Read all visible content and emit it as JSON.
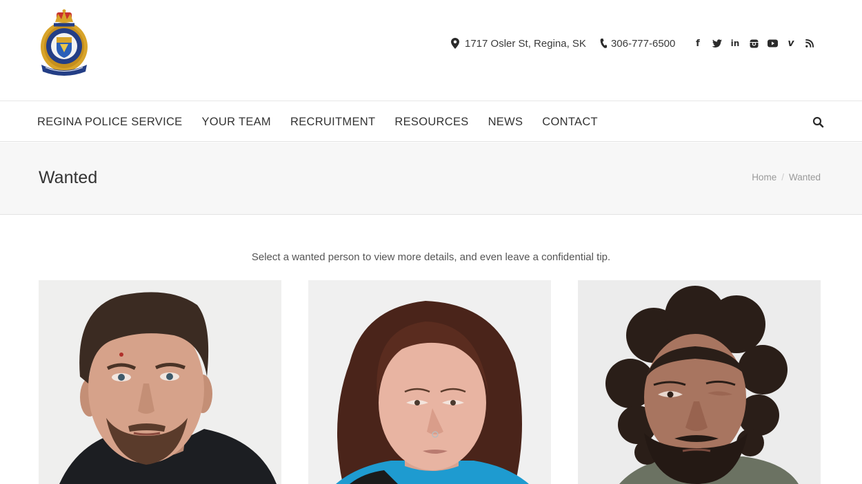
{
  "header": {
    "address": "1717 Osler St, Regina, SK",
    "phone": "306-777-6500",
    "social": [
      {
        "name": "facebook-icon",
        "glyph": "f"
      },
      {
        "name": "twitter-icon",
        "glyph": ""
      },
      {
        "name": "linkedin-icon",
        "glyph": "in"
      },
      {
        "name": "instagram-icon",
        "glyph": ""
      },
      {
        "name": "youtube-icon",
        "glyph": ""
      },
      {
        "name": "vimeo-icon",
        "glyph": "v"
      },
      {
        "name": "rss-icon",
        "glyph": ""
      }
    ]
  },
  "nav": {
    "items": [
      "REGINA POLICE SERVICE",
      "YOUR TEAM",
      "RECRUITMENT",
      "RESOURCES",
      "NEWS",
      "CONTACT"
    ]
  },
  "page": {
    "title": "Wanted",
    "breadcrumb": [
      "Home",
      "Wanted"
    ]
  },
  "main": {
    "intro": "Select a wanted person to view more details, and even leave a confidential tip."
  },
  "colors": {
    "accent": "#2a4f95",
    "text": "#333333"
  }
}
